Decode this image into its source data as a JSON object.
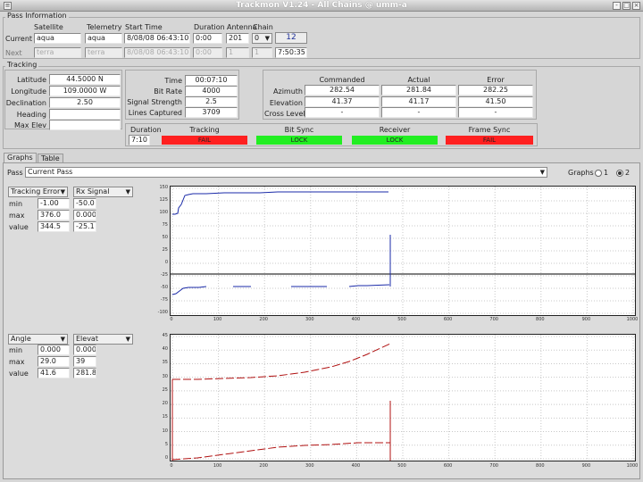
{
  "window": {
    "title": "Trackmon V1.24 - All Chains @ umm-a",
    "buttons": [
      "-",
      "□",
      "×"
    ]
  },
  "pass_info": {
    "group_label": "Pass Information",
    "headers": [
      "Satellite",
      "Telemetry",
      "Start Time",
      "Duration",
      "Antenna",
      "Chain"
    ],
    "current": {
      "label": "Current",
      "satellite": "aqua",
      "telemetry": "aqua",
      "start_time": "8/08/08 06:43:10",
      "duration": "0:00",
      "antenna": "201",
      "chain": "0",
      "button": "12"
    },
    "next": {
      "label": "Next",
      "satellite": "terra",
      "telemetry": "terra",
      "start_time": "8/08/08 06:43:10",
      "duration": "0:00",
      "antenna": "1",
      "chain": "1",
      "countdown": "7:50:35"
    }
  },
  "tracking": {
    "group_label": "Tracking",
    "left": [
      {
        "label": "Latitude",
        "value": "44.5000 N"
      },
      {
        "label": "Longitude",
        "value": "109.0000 W"
      },
      {
        "label": "Declination",
        "value": "2.50"
      },
      {
        "label": "Heading",
        "value": ""
      },
      {
        "label": "Max Elev",
        "value": ""
      }
    ],
    "middle": [
      {
        "label": "Time",
        "value": "00:07:10"
      },
      {
        "label": "Bit Rate",
        "value": "4000"
      },
      {
        "label": "Signal Strength",
        "value": "2.5"
      },
      {
        "label": "Lines Captured",
        "value": "3709"
      }
    ],
    "right_headers": [
      "Commanded",
      "Actual",
      "Error"
    ],
    "right_rows": [
      {
        "label": "Azimuth",
        "values": [
          "282.54",
          "281.84",
          "282.25"
        ]
      },
      {
        "label": "Elevation",
        "values": [
          "41.37",
          "41.17",
          "41.50"
        ]
      },
      {
        "label": "Cross Level",
        "values": [
          "-",
          "-",
          "-"
        ]
      }
    ],
    "duration": {
      "label": "Duration",
      "value": "7:10"
    },
    "indicators": [
      {
        "label": "Tracking",
        "state": "FAIL",
        "color": "#ff2020"
      },
      {
        "label": "Bit Sync",
        "state": "LOCK",
        "color": "#22ee22"
      },
      {
        "label": "Receiver",
        "state": "LOCK",
        "color": "#22ee22"
      },
      {
        "label": "Frame Sync",
        "state": "FAIL",
        "color": "#ff2020"
      }
    ]
  },
  "tabs": [
    "Graphs",
    "Table"
  ],
  "pass_select": {
    "label": "Pass",
    "value": "Current Pass"
  },
  "graph_radio": {
    "label": "Graphs",
    "options": [
      "1",
      "2"
    ],
    "selected": "2"
  },
  "graph1": {
    "left_select": "Tracking Error",
    "right_select": "Rx Signal",
    "rows": [
      {
        "label": "min",
        "a": "-1.00",
        "b": "-50.0"
      },
      {
        "label": "max",
        "a": "376.0",
        "b": "0.000"
      },
      {
        "label": "value",
        "a": "344.5",
        "b": "-25.1"
      }
    ],
    "y_ticks": [
      "150",
      "125",
      "100",
      "75",
      "50",
      "25",
      "0",
      "-25",
      "-50",
      "-75",
      "-100"
    ],
    "x_ticks": [
      "0",
      "100",
      "200",
      "300",
      "400",
      "500",
      "600",
      "700",
      "800",
      "900",
      "1000"
    ],
    "line_color": "#1a2aa8"
  },
  "graph2": {
    "left_select": "Angle",
    "right_select": "Elevat",
    "rows": [
      {
        "label": "min",
        "a": "0.000",
        "b": "0.000"
      },
      {
        "label": "max",
        "a": "29.0",
        "b": "39"
      },
      {
        "label": "value",
        "a": "41.6",
        "b": "281.8"
      }
    ],
    "y_ticks": [
      "45",
      "40",
      "35",
      "30",
      "25",
      "20",
      "15",
      "10",
      "5",
      "0"
    ],
    "x_ticks": [
      "0",
      "100",
      "200",
      "300",
      "400",
      "500",
      "600",
      "700",
      "800",
      "900",
      "1000"
    ],
    "line_color": "#b01010"
  }
}
